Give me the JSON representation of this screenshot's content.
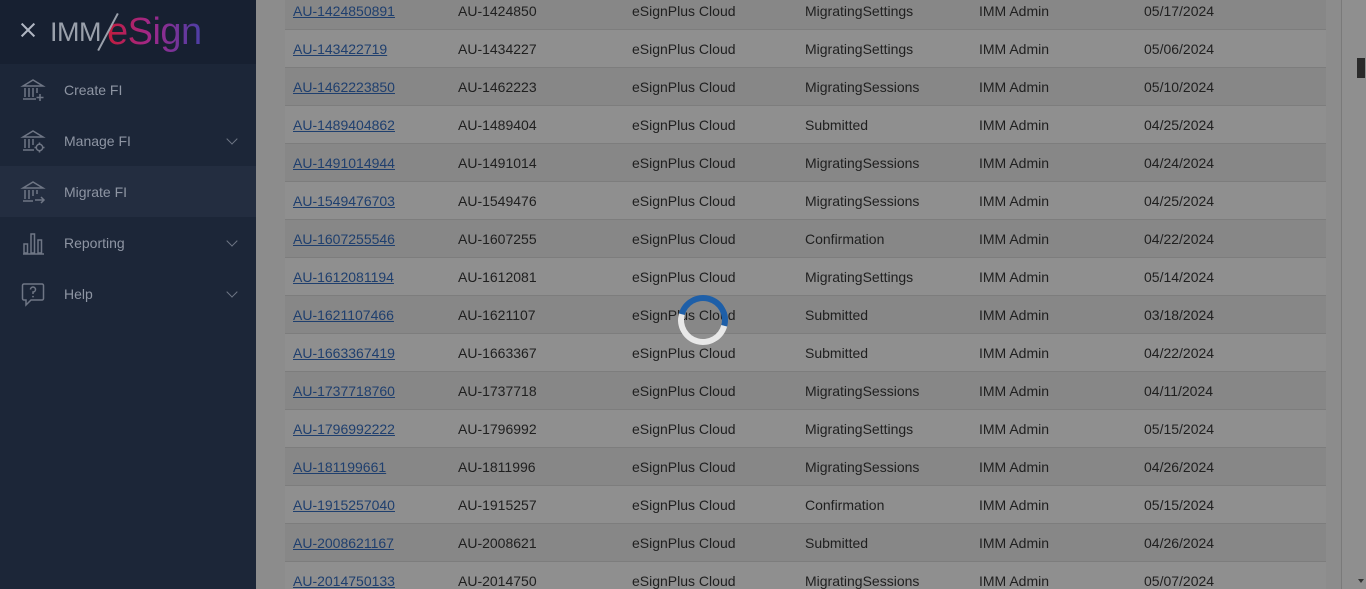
{
  "sidebar": {
    "close_label": "",
    "logo": {
      "left": "IMM",
      "right": "eSign"
    },
    "items": [
      {
        "label": "Create FI",
        "icon": "bank-plus-icon",
        "has_submenu": false,
        "active": false
      },
      {
        "label": "Manage FI",
        "icon": "bank-gear-icon",
        "has_submenu": true,
        "active": false
      },
      {
        "label": "Migrate FI",
        "icon": "bank-arrow-icon",
        "has_submenu": false,
        "active": true
      },
      {
        "label": "Reporting",
        "icon": "bar-chart-icon",
        "has_submenu": true,
        "active": false
      },
      {
        "label": "Help",
        "icon": "help-bubble-icon",
        "has_submenu": true,
        "active": false
      }
    ]
  },
  "table": {
    "rows": [
      {
        "id": "AU-1424850891",
        "code": "AU-1424850",
        "product": "eSignPlus Cloud",
        "status": "MigratingSettings",
        "user": "IMM Admin",
        "date": "05/17/2024"
      },
      {
        "id": "AU-143422719",
        "code": "AU-1434227",
        "product": "eSignPlus Cloud",
        "status": "MigratingSettings",
        "user": "IMM Admin",
        "date": "05/06/2024"
      },
      {
        "id": "AU-1462223850",
        "code": "AU-1462223",
        "product": "eSignPlus Cloud",
        "status": "MigratingSessions",
        "user": "IMM Admin",
        "date": "05/10/2024"
      },
      {
        "id": "AU-1489404862",
        "code": "AU-1489404",
        "product": "eSignPlus Cloud",
        "status": "Submitted",
        "user": "IMM Admin",
        "date": "04/25/2024"
      },
      {
        "id": "AU-1491014944",
        "code": "AU-1491014",
        "product": "eSignPlus Cloud",
        "status": "MigratingSessions",
        "user": "IMM Admin",
        "date": "04/24/2024"
      },
      {
        "id": "AU-1549476703",
        "code": "AU-1549476",
        "product": "eSignPlus Cloud",
        "status": "MigratingSessions",
        "user": "IMM Admin",
        "date": "04/25/2024"
      },
      {
        "id": "AU-1607255546",
        "code": "AU-1607255",
        "product": "eSignPlus Cloud",
        "status": "Confirmation",
        "user": "IMM Admin",
        "date": "04/22/2024"
      },
      {
        "id": "AU-1612081194",
        "code": "AU-1612081",
        "product": "eSignPlus Cloud",
        "status": "MigratingSettings",
        "user": "IMM Admin",
        "date": "05/14/2024"
      },
      {
        "id": "AU-1621107466",
        "code": "AU-1621107",
        "product": "eSignPlus Cloud",
        "status": "Submitted",
        "user": "IMM Admin",
        "date": "03/18/2024"
      },
      {
        "id": "AU-1663367419",
        "code": "AU-1663367",
        "product": "eSignPlus Cloud",
        "status": "Submitted",
        "user": "IMM Admin",
        "date": "04/22/2024"
      },
      {
        "id": "AU-1737718760",
        "code": "AU-1737718",
        "product": "eSignPlus Cloud",
        "status": "MigratingSessions",
        "user": "IMM Admin",
        "date": "04/11/2024"
      },
      {
        "id": "AU-1796992222",
        "code": "AU-1796992",
        "product": "eSignPlus Cloud",
        "status": "MigratingSettings",
        "user": "IMM Admin",
        "date": "05/15/2024"
      },
      {
        "id": "AU-181199661",
        "code": "AU-1811996",
        "product": "eSignPlus Cloud",
        "status": "MigratingSessions",
        "user": "IMM Admin",
        "date": "04/26/2024"
      },
      {
        "id": "AU-1915257040",
        "code": "AU-1915257",
        "product": "eSignPlus Cloud",
        "status": "Confirmation",
        "user": "IMM Admin",
        "date": "05/15/2024"
      },
      {
        "id": "AU-2008621167",
        "code": "AU-2008621",
        "product": "eSignPlus Cloud",
        "status": "Submitted",
        "user": "IMM Admin",
        "date": "04/26/2024"
      },
      {
        "id": "AU-2014750133",
        "code": "AU-2014750",
        "product": "eSignPlus Cloud",
        "status": "MigratingSessions",
        "user": "IMM Admin",
        "date": "05/07/2024"
      }
    ]
  },
  "loading": {
    "icon": "loading-spinner-icon",
    "color": "#1e5fa8"
  }
}
